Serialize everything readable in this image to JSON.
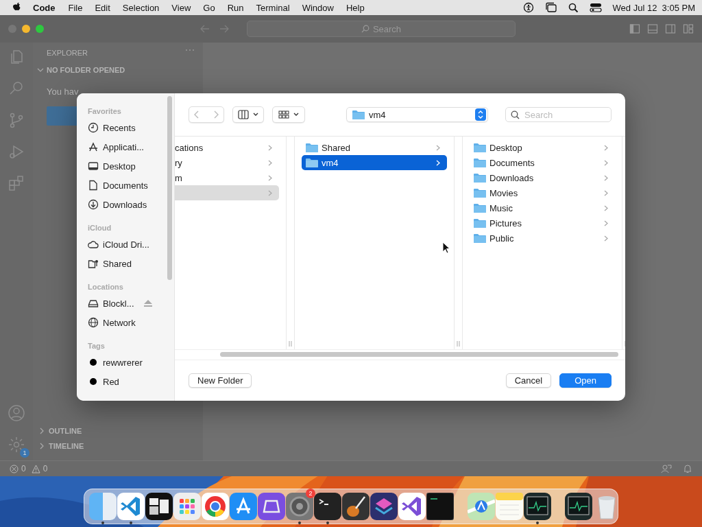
{
  "menubar": {
    "app_name": "Code",
    "menus": [
      "File",
      "Edit",
      "Selection",
      "View",
      "Go",
      "Run",
      "Terminal",
      "Window",
      "Help"
    ],
    "clock": "Wed Jul 12  3:05 PM"
  },
  "window": {
    "search_placeholder": "Search",
    "explorer": {
      "title": "EXPLORER",
      "section": {
        "label": "NO FOLDER OPENED",
        "expanded": true
      },
      "message": "You hav"
    },
    "panels": [
      {
        "label": "OUTLINE",
        "expanded": false
      },
      {
        "label": "TIMELINE",
        "expanded": false
      }
    ],
    "settings_badge": "1",
    "status_bar": {
      "errors": "0",
      "warnings": "0"
    }
  },
  "dialog": {
    "sidebar": [
      {
        "title": "Favorites",
        "items": [
          {
            "kind": "clock",
            "label": "Recents"
          },
          {
            "kind": "apps",
            "label": "Applicati..."
          },
          {
            "kind": "desktop",
            "label": "Desktop"
          },
          {
            "kind": "document",
            "label": "Documents"
          },
          {
            "kind": "download",
            "label": "Downloads"
          }
        ]
      },
      {
        "title": "iCloud",
        "items": [
          {
            "kind": "cloud",
            "label": "iCloud Dri..."
          },
          {
            "kind": "shared",
            "label": "Shared"
          }
        ]
      },
      {
        "title": "Locations",
        "items": [
          {
            "kind": "drive",
            "label": "Blockl...",
            "ejectable": true
          },
          {
            "kind": "globe",
            "label": "Network"
          }
        ]
      },
      {
        "title": "Tags",
        "items": [
          {
            "kind": "tag",
            "label": "rewwrerer",
            "color": "#000000"
          },
          {
            "kind": "tag",
            "label": "Red",
            "color": "#000000"
          }
        ]
      }
    ],
    "location": "vm4",
    "search_placeholder": "Search",
    "columns": [
      {
        "focused": false,
        "items": [
          {
            "label": "cations",
            "selected": false
          },
          {
            "label": "ry",
            "selected": false
          },
          {
            "label": "m",
            "selected": false
          },
          {
            "selected": true
          }
        ]
      },
      {
        "focused": true,
        "items": [
          {
            "label": "Shared",
            "selected": false
          },
          {
            "label": "vm4",
            "selected": true
          }
        ]
      },
      {
        "items": [
          {
            "label": "Desktop",
            "selected": false
          },
          {
            "label": "Documents",
            "selected": false
          },
          {
            "label": "Downloads",
            "selected": false
          },
          {
            "label": "Movies",
            "selected": false
          },
          {
            "label": "Music",
            "selected": false
          },
          {
            "label": "Pictures",
            "selected": false
          },
          {
            "label": "Public",
            "selected": false
          }
        ]
      }
    ],
    "buttons": [
      {
        "label": "New Folder",
        "kind": "plain"
      },
      {
        "label": "Cancel",
        "kind": "plain"
      },
      {
        "label": "Open",
        "kind": "default"
      }
    ]
  },
  "dock": [
    {
      "kind": "finder",
      "running": true
    },
    {
      "kind": "code",
      "running": true
    },
    {
      "kind": "windows",
      "running": false
    },
    {
      "kind": "grid",
      "running": false
    },
    {
      "kind": "ring",
      "running": false
    },
    {
      "kind": "store",
      "running": false
    },
    {
      "kind": "tray",
      "running": false
    },
    {
      "kind": "gear",
      "running": true,
      "badge": "2"
    },
    {
      "kind": "terminal",
      "running": true
    },
    {
      "kind": "guitar",
      "running": false
    },
    {
      "kind": "layers",
      "running": false
    },
    {
      "kind": "ribbon",
      "running": false
    },
    {
      "kind": "console",
      "running": false
    },
    {
      "kind": "separator"
    },
    {
      "kind": "map",
      "running": false
    },
    {
      "kind": "notes",
      "running": false
    },
    {
      "kind": "monitor",
      "running": true
    },
    {
      "kind": "separator"
    },
    {
      "kind": "monitor",
      "running": false
    },
    {
      "kind": "trash",
      "running": false
    }
  ]
}
